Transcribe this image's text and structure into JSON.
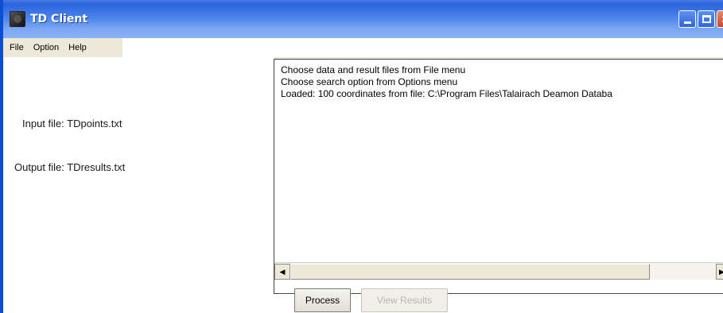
{
  "window": {
    "title": "TD Client"
  },
  "titlebar": {
    "minimize_icon": "minimize-icon",
    "maximize_icon": "maximize-icon",
    "close_icon": "close-icon",
    "close_glyph": "✕"
  },
  "menubar": {
    "items": [
      {
        "label": "File"
      },
      {
        "label": "Option"
      },
      {
        "label": "Help"
      }
    ]
  },
  "left_panel": {
    "input_file_label": "Input file: TDpoints.txt",
    "output_file_label": "Output file: TDresults.txt"
  },
  "log": {
    "lines": [
      "Choose data and result files from File menu",
      "Choose search option from Options menu",
      "Loaded: 100 coordinates from file: C:\\Program Files\\Talairach Deamon Databa"
    ]
  },
  "scrollbar": {
    "left_arrow": "◀",
    "right_arrow": "▶"
  },
  "buttons": {
    "process_label": "Process",
    "view_results_label": "View Results",
    "view_results_enabled": false
  },
  "colors": {
    "titlebar_accent": "#2a63db",
    "close_button": "#c7452b",
    "disabled_text": "#b8b4a8"
  }
}
